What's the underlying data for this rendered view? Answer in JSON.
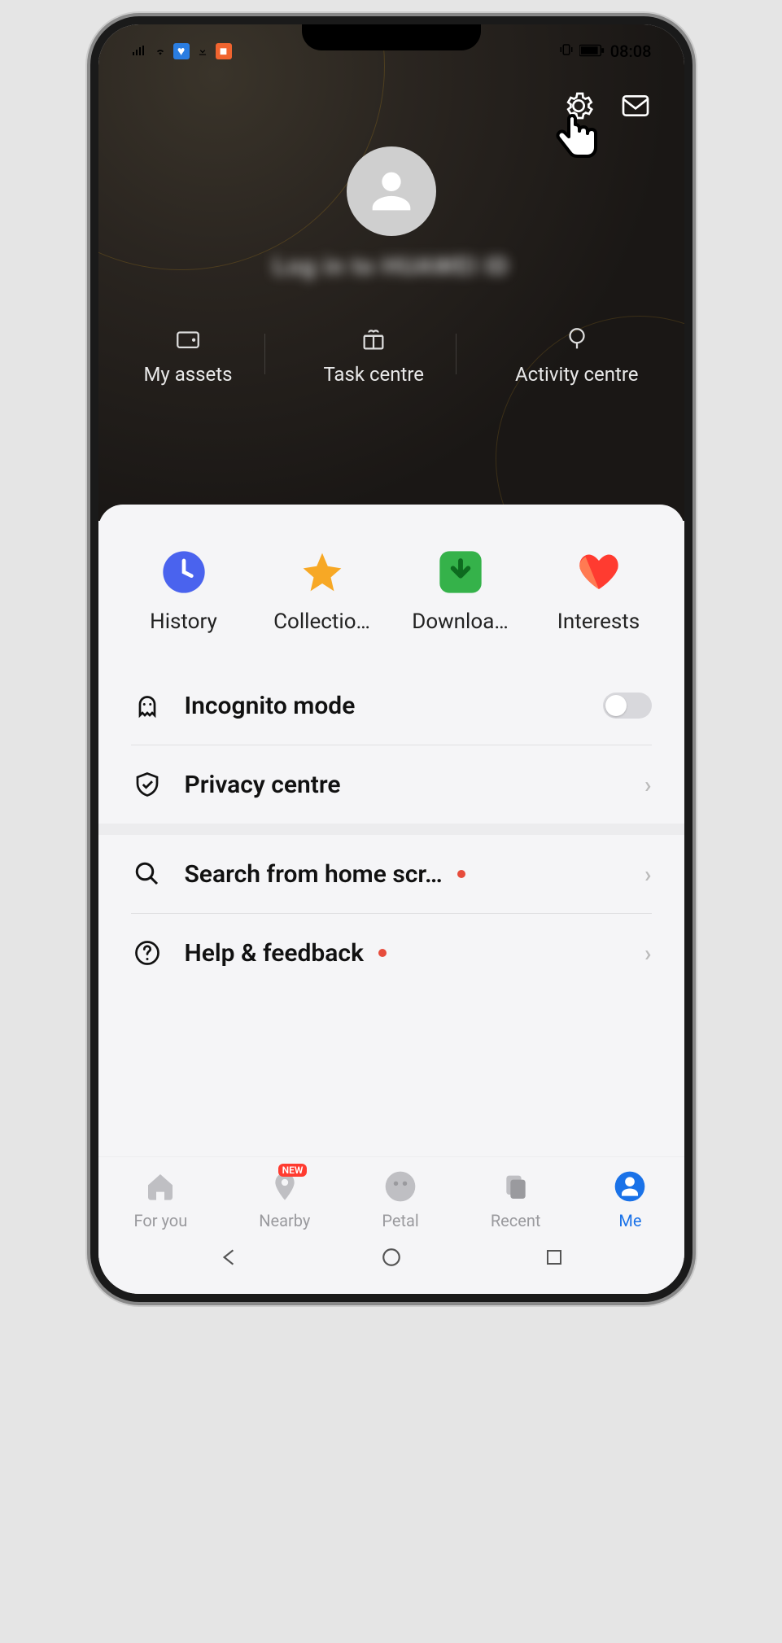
{
  "status": {
    "time": "08:08"
  },
  "hero": {
    "login_text": "Log in to HUAWEI ID",
    "tiles": [
      {
        "label": "My assets"
      },
      {
        "label": "Task centre"
      },
      {
        "label": "Activity centre"
      }
    ]
  },
  "quick": [
    {
      "label": "History"
    },
    {
      "label": "Collectio…"
    },
    {
      "label": "Downloa…"
    },
    {
      "label": "Interests"
    }
  ],
  "settings_a": [
    {
      "label": "Incognito mode",
      "type": "toggle"
    },
    {
      "label": "Privacy centre",
      "type": "link"
    }
  ],
  "settings_b": [
    {
      "label": "Search from home scr…",
      "dot": true,
      "type": "link"
    },
    {
      "label": "Help & feedback",
      "dot": true,
      "type": "link"
    }
  ],
  "nav": [
    {
      "label": "For you"
    },
    {
      "label": "Nearby",
      "badge": "NEW"
    },
    {
      "label": "Petal"
    },
    {
      "label": "Recent"
    },
    {
      "label": "Me",
      "active": true
    }
  ]
}
